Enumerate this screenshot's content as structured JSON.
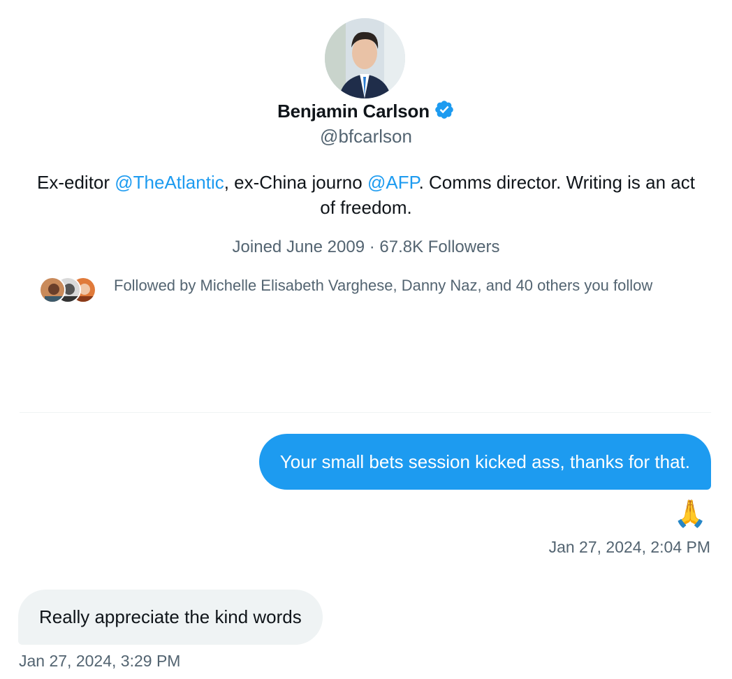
{
  "profile": {
    "name": "Benjamin Carlson",
    "handle": "@bfcarlson",
    "verified_icon": "verified-badge-icon",
    "bio": {
      "part1": "Ex-editor ",
      "mention1": "@TheAtlantic",
      "part2": ", ex-China journo ",
      "mention2": "@AFP",
      "part3": ". Comms director. Writing is an act of freedom."
    },
    "meta": "Joined June 2009 · 67.8K Followers",
    "followed_by": "Followed by Michelle Elisabeth Varghese, Danny Naz, and 40 others you follow"
  },
  "messages": [
    {
      "direction": "outgoing",
      "text": "Your small bets session kicked ass, thanks for that.",
      "reaction": "🙏",
      "timestamp": "Jan 27, 2024, 2:04 PM"
    },
    {
      "direction": "incoming",
      "text": "Really appreciate the kind words",
      "timestamp": "Jan 27, 2024, 3:29 PM"
    }
  ],
  "colors": {
    "accent": "#1d9bf0",
    "text_primary": "#0f1419",
    "text_secondary": "#536471",
    "incoming_bubble": "#eff3f4"
  }
}
